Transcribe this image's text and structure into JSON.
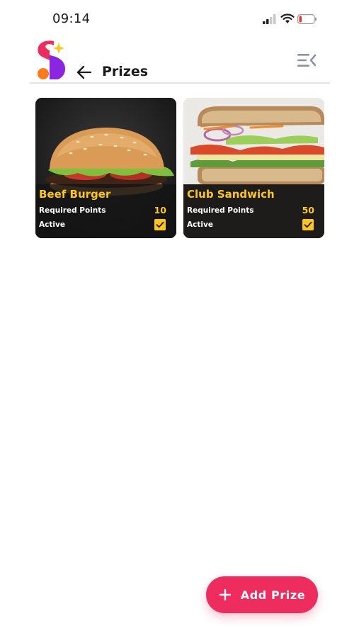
{
  "status_bar": {
    "time": "09:14",
    "battery_color": "#e53935"
  },
  "header": {
    "title": "Prizes",
    "logo_colors": {
      "orange": "#ff7a1a",
      "pink": "#ef2c5e",
      "purple": "#8a25e0",
      "star": "#ffc61a"
    }
  },
  "prizes": [
    {
      "name": "Beef Burger",
      "points_label": "Required Points",
      "points": "10",
      "active_label": "Active",
      "active": true,
      "image": "burger-image"
    },
    {
      "name": "Club Sandwich",
      "points_label": "Required Points",
      "points": "50",
      "active_label": "Active",
      "active": true,
      "image": "sandwich-image"
    }
  ],
  "fab": {
    "label": "Add Prize",
    "icon": "plus-icon",
    "color": "#ef2c5e"
  },
  "theme": {
    "accent_yellow": "#ffc61a",
    "divider": "#e3e3e3"
  }
}
